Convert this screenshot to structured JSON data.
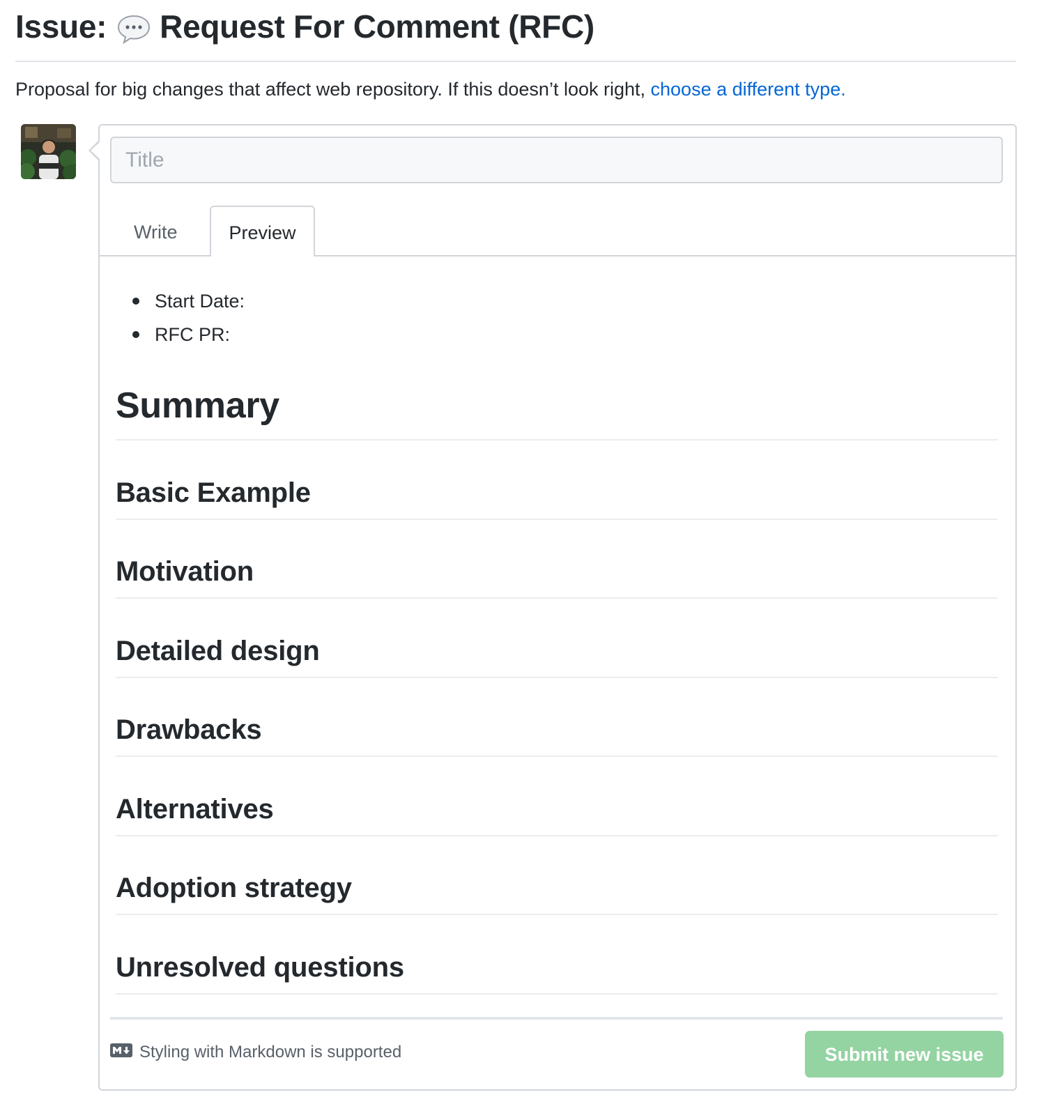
{
  "header": {
    "prefix": "Issue:",
    "title": "Request For Comment (RFC)"
  },
  "description": {
    "text": "Proposal for big changes that affect web repository. If this doesn’t look right, ",
    "link_text": "choose a different type."
  },
  "form": {
    "title_placeholder": "Title",
    "tabs": [
      {
        "label": "Write",
        "active": false
      },
      {
        "label": "Preview",
        "active": true
      }
    ],
    "preview": {
      "bullets": [
        "Start Date:",
        "RFC PR:"
      ],
      "h1": "Summary",
      "sections": [
        "Basic Example",
        "Motivation",
        "Detailed design",
        "Drawbacks",
        "Alternatives",
        "Adoption strategy",
        "Unresolved questions"
      ]
    },
    "markdown_hint": "Styling with Markdown is supported",
    "submit_label": "Submit new issue"
  },
  "colors": {
    "link": "#0366d6",
    "submit_disabled_bg": "#94d3a2",
    "border": "#d1d5da",
    "text": "#24292e"
  },
  "icons": {
    "title_emoji": "speech-balloon-icon",
    "markdown": "markdown-icon"
  }
}
